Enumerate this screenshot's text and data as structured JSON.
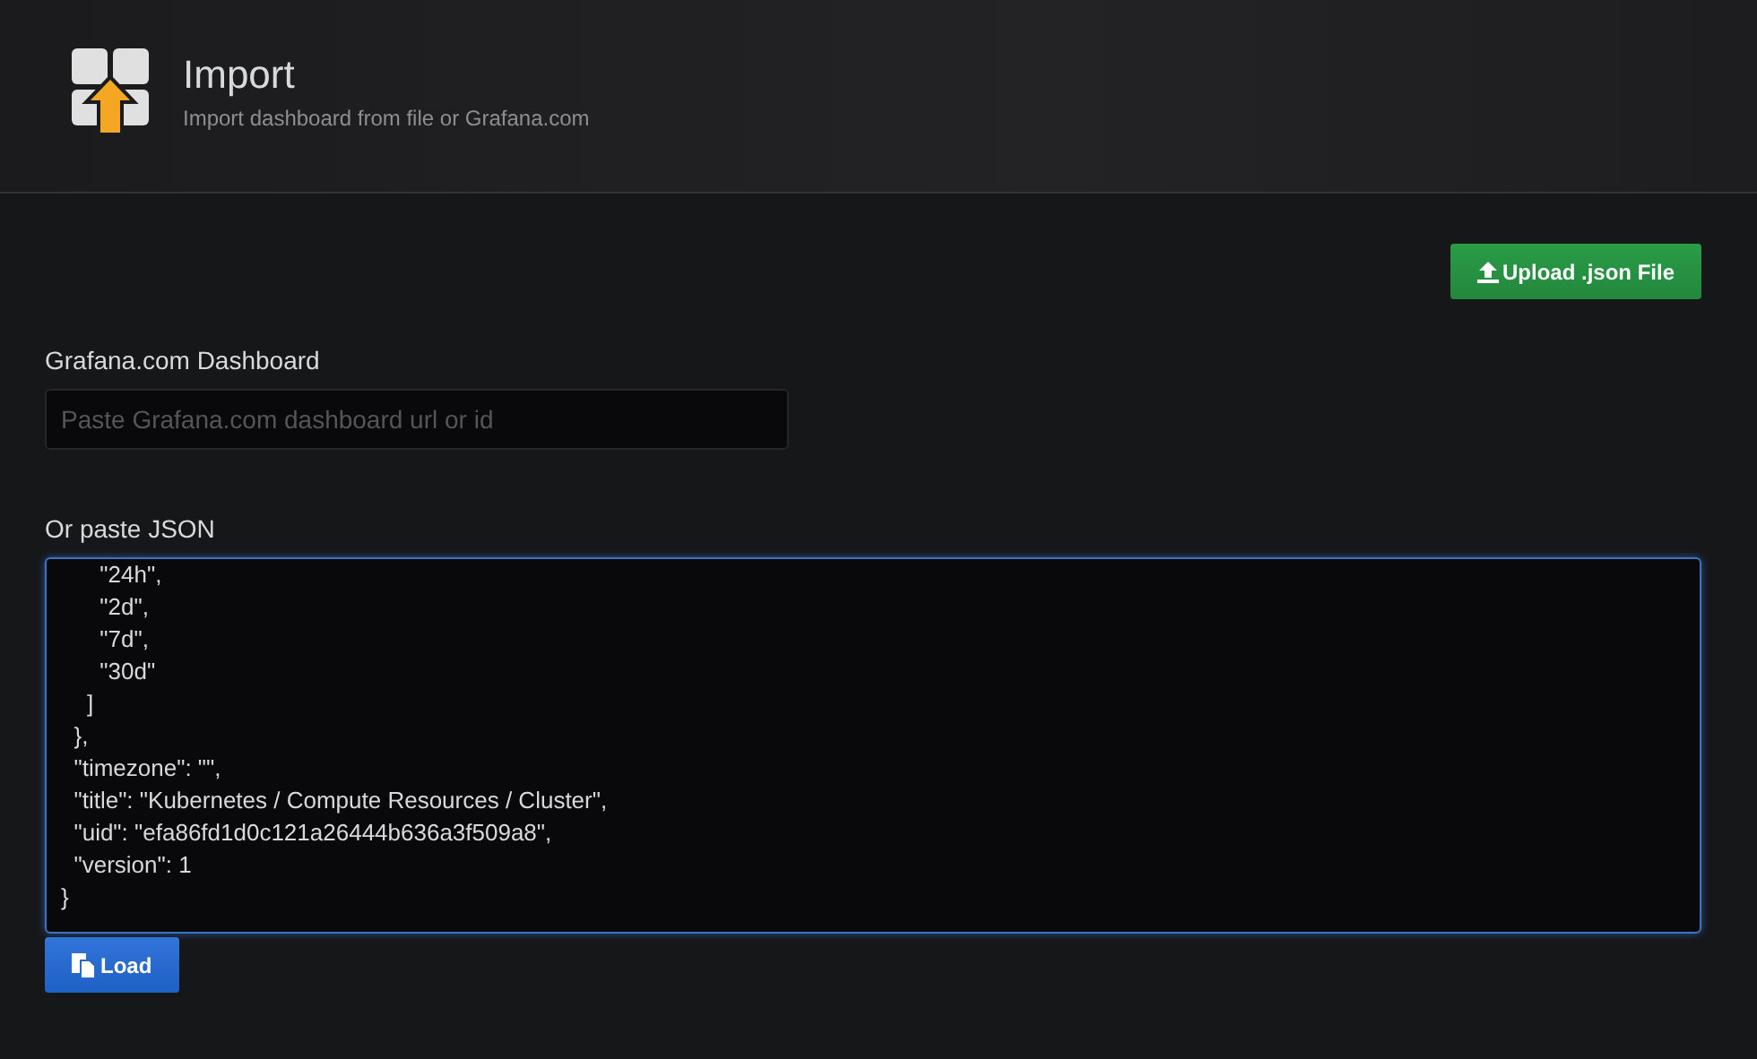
{
  "header": {
    "title": "Import",
    "subtitle": "Import dashboard from file or Grafana.com"
  },
  "upload_button": {
    "label": "Upload .json File"
  },
  "grafana_field": {
    "label": "Grafana.com Dashboard",
    "placeholder": "Paste Grafana.com dashboard url or id"
  },
  "json_field": {
    "label": "Or paste JSON",
    "lines": [
      "      \"24h\",",
      "      \"2d\",",
      "      \"7d\",",
      "      \"30d\"",
      "    ]",
      "  },",
      "  \"timezone\": \"\",",
      "  \"title\": \"Kubernetes / Compute Resources / Cluster\",",
      "  \"uid\": \"efa86fd1d0c121a26444b636a3f509a8\",",
      "  \"version\": 1",
      "}"
    ]
  },
  "load_button": {
    "label": "Load"
  }
}
